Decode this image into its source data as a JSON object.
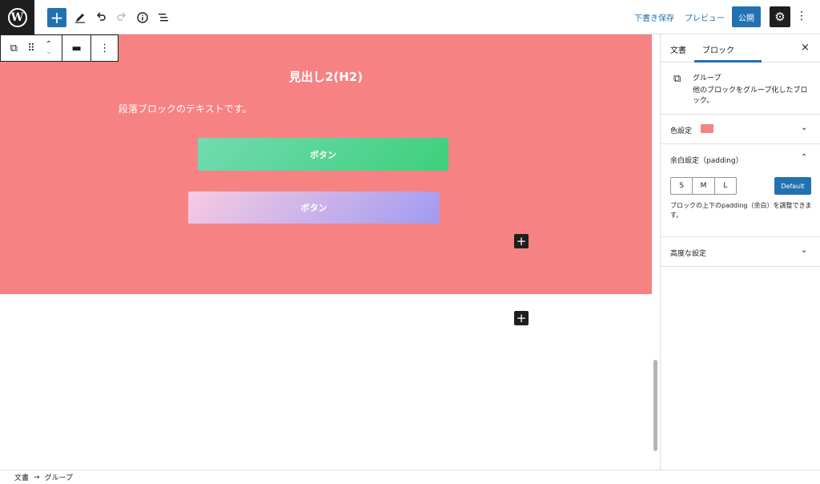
{
  "topbar": {
    "logo": "W",
    "add_icon": "+",
    "save_draft": "下書き保存",
    "preview": "プレビュー",
    "publish": "公開",
    "settings_icon": "⚙",
    "more_icon": "⋮"
  },
  "block_toolbar": {
    "group_icon": "⧉",
    "drag_icon": "⠿",
    "move_up": "⌃",
    "move_down": "⌄",
    "align_icon": "▬",
    "options_icon": "⋮"
  },
  "content": {
    "heading": "見出し2(H2)",
    "paragraph": "段落ブロックのテキストです。",
    "button1": "ボタン",
    "button2": "ボタン",
    "plus": "+"
  },
  "footer": {
    "crumb1": "文書",
    "arrow": "→",
    "crumb2": "グループ"
  },
  "sidebar": {
    "tab_document": "文書",
    "tab_block": "ブロック",
    "close": "×",
    "block_name": "グループ",
    "block_desc": "他のブロックをグループ化したブロック。",
    "color_label": "色設定",
    "color_value": "#f78283",
    "padding_label": "余白設定（padding）",
    "sizes": [
      "S",
      "M",
      "L"
    ],
    "default": "Default",
    "padding_desc": "ブロックの上下のpadding（余白）を調整できます。",
    "advanced": "高度な設定",
    "chev_down": "⌄",
    "chev_up": "⌃"
  }
}
